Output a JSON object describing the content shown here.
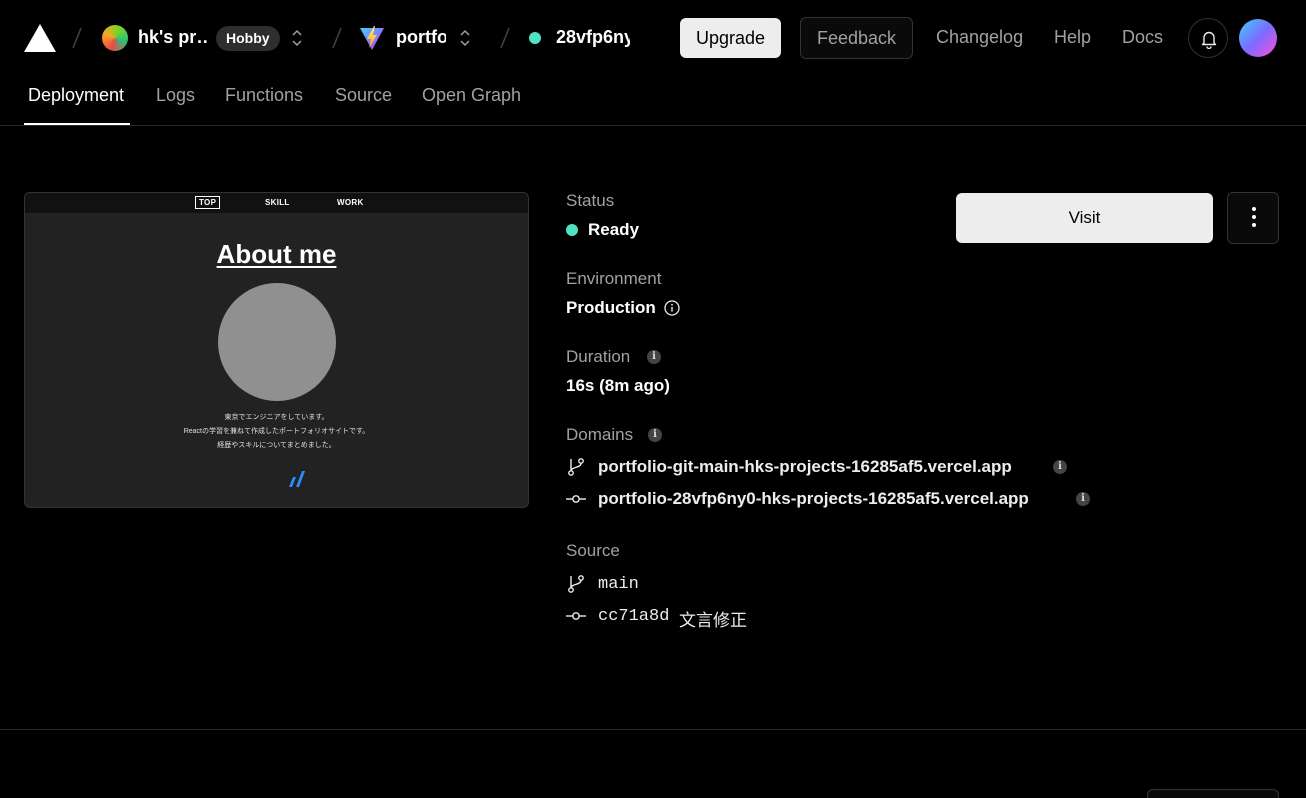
{
  "header": {
    "team_name": "hk's pr…",
    "plan_badge": "Hobby",
    "project_name": "portfo",
    "deployment_id": "28vfp6ny",
    "upgrade_label": "Upgrade",
    "feedback_label": "Feedback",
    "links": [
      "Changelog",
      "Help",
      "Docs"
    ]
  },
  "tabs": [
    "Deployment",
    "Logs",
    "Functions",
    "Source",
    "Open Graph"
  ],
  "preview": {
    "nav": [
      "TOP",
      "SKILL",
      "WORK"
    ],
    "heading": "About me",
    "lines": [
      "東京でエンジニアをしています。",
      "Reactの学習を兼ねて作成したポートフォリオサイトです。",
      "経歴やスキルについてまとめました。"
    ]
  },
  "details": {
    "status_label": "Status",
    "status_value": "Ready",
    "environment_label": "Environment",
    "environment_value": "Production",
    "duration_label": "Duration",
    "duration_value": "16s (8m ago)",
    "domains_label": "Domains",
    "domains": [
      "portfolio-git-main-hks-projects-16285af5.vercel.app",
      "portfolio-28vfp6ny0-hks-projects-16285af5.vercel.app"
    ],
    "source_label": "Source",
    "branch": "main",
    "commit_hash": "cc71a8d",
    "commit_message": "文言修正"
  },
  "actions": {
    "visit_label": "Visit"
  },
  "colors": {
    "ready": "#50e3c2",
    "background": "#000000"
  },
  "icons": [
    "vercel-logo-icon",
    "chevron-updown-icon",
    "vite-icon",
    "bell-icon",
    "info-icon",
    "git-branch-icon",
    "git-commit-icon",
    "more-vertical-icon"
  ]
}
